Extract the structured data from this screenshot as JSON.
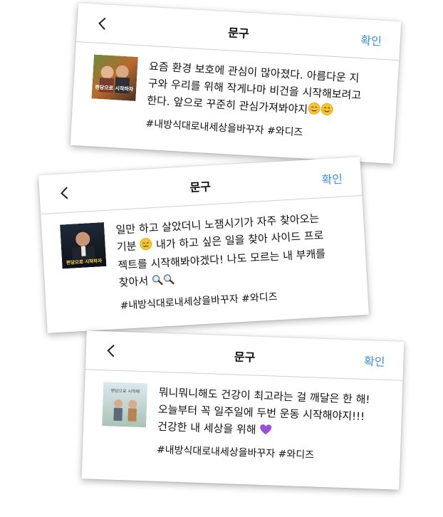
{
  "cards": [
    {
      "header": {
        "title": "문구",
        "confirm": "확인"
      },
      "poster_text": "편당으로 시작하자",
      "caption": "요즘 환경 보호에 관심이 많아졌다. 아름다운 지\n구와 우리를 위해 작게나마 비건을 시작해보려고\n한다. 앞으로 꾸준히 관심가져봐야지",
      "emoji": [
        "smiling-face",
        "smiling-face"
      ],
      "hashtags": "#내방식대로내세상을바꾸자 #와디즈"
    },
    {
      "header": {
        "title": "문구",
        "confirm": "확인"
      },
      "poster_text": "편당으로 시작하자",
      "caption_part1": "일만 하고 살았더니 노잼시기가 자주 찾아오는\n기분",
      "caption_part2": " 내가 하고 싶은 일을 찾아 사이드 프로\n젝트를 시작해봐야겠다! 나도 모르는 내 부캐를\n찾아서",
      "emoji": [
        "crying-face",
        "magnifier",
        "magnifier"
      ],
      "hashtags": "#내방식대로내세상을바꾸자 #와디즈"
    },
    {
      "header": {
        "title": "문구",
        "confirm": "확인"
      },
      "poster_text": "편당으로 시작해",
      "caption": "뭐니뭐니해도 건강이 최고라는 걸 깨달은 한 해!\n오늘부터 꼭 일주일에 두번 운동 시작해야지!!!\n건강한 내 세상을 위해",
      "emoji": [
        "purple-heart"
      ],
      "hashtags": "#내방식대로내세상을바꾸자 #와디즈"
    }
  ],
  "colors": {
    "confirm": "#3a8ee6",
    "divider": "#cfcfcf",
    "text": "#111111"
  }
}
